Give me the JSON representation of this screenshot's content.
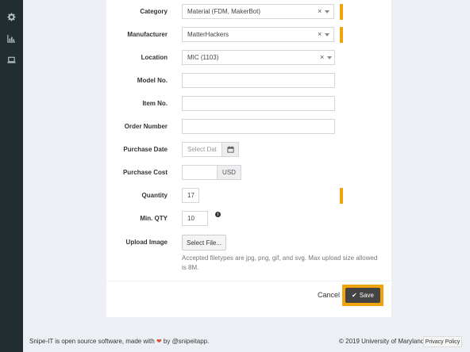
{
  "sidebar": {
    "icons": [
      "gear-icon",
      "bar-chart-icon",
      "laptop-icon"
    ]
  },
  "form": {
    "category": {
      "label": "Category",
      "value": "Material (FDM, MakerBot)",
      "clear": "×"
    },
    "manufacturer": {
      "label": "Manufacturer",
      "value": "MatterHackers",
      "clear": "×"
    },
    "location": {
      "label": "Location",
      "value": "MIC (1103)",
      "clear": "×"
    },
    "model_no": {
      "label": "Model No.",
      "value": ""
    },
    "item_no": {
      "label": "Item No.",
      "value": ""
    },
    "order_number": {
      "label": "Order Number",
      "value": ""
    },
    "purchase_date": {
      "label": "Purchase Date",
      "placeholder": "Select Dat"
    },
    "purchase_cost": {
      "label": "Purchase Cost",
      "value": "",
      "currency": "USD"
    },
    "quantity": {
      "label": "Quantity",
      "value": "17"
    },
    "min_qty": {
      "label": "Min. QTY",
      "value": "10"
    },
    "upload_image": {
      "label": "Upload Image",
      "button": "Select File...",
      "help": "Accepted filetypes are jpg, png, gif, and svg. Max upload size allowed is 8M."
    }
  },
  "actions": {
    "cancel": "Cancel",
    "save": "Save"
  },
  "footer": {
    "text_before": "Snipe-IT is open source software, made with",
    "heart": "❤",
    "text_after": "by @snipeitapp.",
    "copyright": "© 2019 University of Maryland",
    "privacy": "Privacy Policy"
  },
  "colors": {
    "sidebar": "#222d32",
    "required": "#f0a30a",
    "save_button": "#444444"
  }
}
